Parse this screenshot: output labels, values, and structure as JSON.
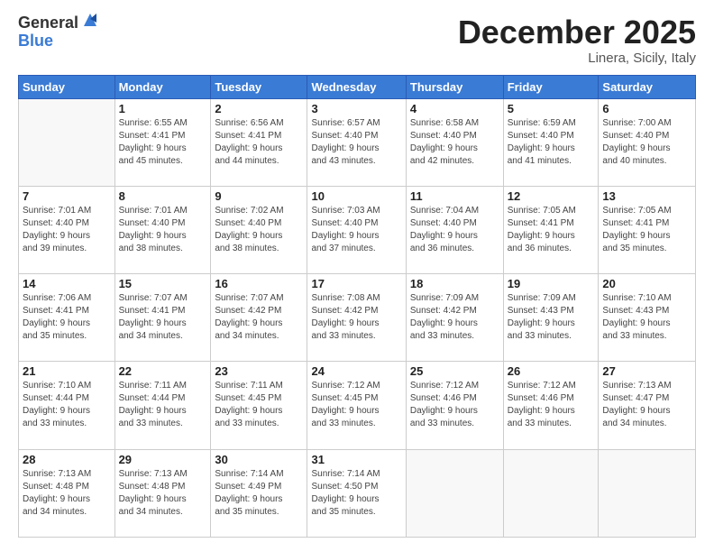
{
  "header": {
    "logo_general": "General",
    "logo_blue": "Blue",
    "month_title": "December 2025",
    "location": "Linera, Sicily, Italy"
  },
  "calendar": {
    "weekdays": [
      "Sunday",
      "Monday",
      "Tuesday",
      "Wednesday",
      "Thursday",
      "Friday",
      "Saturday"
    ],
    "weeks": [
      [
        {
          "day": "",
          "info": ""
        },
        {
          "day": "1",
          "info": "Sunrise: 6:55 AM\nSunset: 4:41 PM\nDaylight: 9 hours\nand 45 minutes."
        },
        {
          "day": "2",
          "info": "Sunrise: 6:56 AM\nSunset: 4:41 PM\nDaylight: 9 hours\nand 44 minutes."
        },
        {
          "day": "3",
          "info": "Sunrise: 6:57 AM\nSunset: 4:40 PM\nDaylight: 9 hours\nand 43 minutes."
        },
        {
          "day": "4",
          "info": "Sunrise: 6:58 AM\nSunset: 4:40 PM\nDaylight: 9 hours\nand 42 minutes."
        },
        {
          "day": "5",
          "info": "Sunrise: 6:59 AM\nSunset: 4:40 PM\nDaylight: 9 hours\nand 41 minutes."
        },
        {
          "day": "6",
          "info": "Sunrise: 7:00 AM\nSunset: 4:40 PM\nDaylight: 9 hours\nand 40 minutes."
        }
      ],
      [
        {
          "day": "7",
          "info": "Sunrise: 7:01 AM\nSunset: 4:40 PM\nDaylight: 9 hours\nand 39 minutes."
        },
        {
          "day": "8",
          "info": "Sunrise: 7:01 AM\nSunset: 4:40 PM\nDaylight: 9 hours\nand 38 minutes."
        },
        {
          "day": "9",
          "info": "Sunrise: 7:02 AM\nSunset: 4:40 PM\nDaylight: 9 hours\nand 38 minutes."
        },
        {
          "day": "10",
          "info": "Sunrise: 7:03 AM\nSunset: 4:40 PM\nDaylight: 9 hours\nand 37 minutes."
        },
        {
          "day": "11",
          "info": "Sunrise: 7:04 AM\nSunset: 4:40 PM\nDaylight: 9 hours\nand 36 minutes."
        },
        {
          "day": "12",
          "info": "Sunrise: 7:05 AM\nSunset: 4:41 PM\nDaylight: 9 hours\nand 36 minutes."
        },
        {
          "day": "13",
          "info": "Sunrise: 7:05 AM\nSunset: 4:41 PM\nDaylight: 9 hours\nand 35 minutes."
        }
      ],
      [
        {
          "day": "14",
          "info": "Sunrise: 7:06 AM\nSunset: 4:41 PM\nDaylight: 9 hours\nand 35 minutes."
        },
        {
          "day": "15",
          "info": "Sunrise: 7:07 AM\nSunset: 4:41 PM\nDaylight: 9 hours\nand 34 minutes."
        },
        {
          "day": "16",
          "info": "Sunrise: 7:07 AM\nSunset: 4:42 PM\nDaylight: 9 hours\nand 34 minutes."
        },
        {
          "day": "17",
          "info": "Sunrise: 7:08 AM\nSunset: 4:42 PM\nDaylight: 9 hours\nand 33 minutes."
        },
        {
          "day": "18",
          "info": "Sunrise: 7:09 AM\nSunset: 4:42 PM\nDaylight: 9 hours\nand 33 minutes."
        },
        {
          "day": "19",
          "info": "Sunrise: 7:09 AM\nSunset: 4:43 PM\nDaylight: 9 hours\nand 33 minutes."
        },
        {
          "day": "20",
          "info": "Sunrise: 7:10 AM\nSunset: 4:43 PM\nDaylight: 9 hours\nand 33 minutes."
        }
      ],
      [
        {
          "day": "21",
          "info": "Sunrise: 7:10 AM\nSunset: 4:44 PM\nDaylight: 9 hours\nand 33 minutes."
        },
        {
          "day": "22",
          "info": "Sunrise: 7:11 AM\nSunset: 4:44 PM\nDaylight: 9 hours\nand 33 minutes."
        },
        {
          "day": "23",
          "info": "Sunrise: 7:11 AM\nSunset: 4:45 PM\nDaylight: 9 hours\nand 33 minutes."
        },
        {
          "day": "24",
          "info": "Sunrise: 7:12 AM\nSunset: 4:45 PM\nDaylight: 9 hours\nand 33 minutes."
        },
        {
          "day": "25",
          "info": "Sunrise: 7:12 AM\nSunset: 4:46 PM\nDaylight: 9 hours\nand 33 minutes."
        },
        {
          "day": "26",
          "info": "Sunrise: 7:12 AM\nSunset: 4:46 PM\nDaylight: 9 hours\nand 33 minutes."
        },
        {
          "day": "27",
          "info": "Sunrise: 7:13 AM\nSunset: 4:47 PM\nDaylight: 9 hours\nand 34 minutes."
        }
      ],
      [
        {
          "day": "28",
          "info": "Sunrise: 7:13 AM\nSunset: 4:48 PM\nDaylight: 9 hours\nand 34 minutes."
        },
        {
          "day": "29",
          "info": "Sunrise: 7:13 AM\nSunset: 4:48 PM\nDaylight: 9 hours\nand 34 minutes."
        },
        {
          "day": "30",
          "info": "Sunrise: 7:14 AM\nSunset: 4:49 PM\nDaylight: 9 hours\nand 35 minutes."
        },
        {
          "day": "31",
          "info": "Sunrise: 7:14 AM\nSunset: 4:50 PM\nDaylight: 9 hours\nand 35 minutes."
        },
        {
          "day": "",
          "info": ""
        },
        {
          "day": "",
          "info": ""
        },
        {
          "day": "",
          "info": ""
        }
      ]
    ]
  }
}
